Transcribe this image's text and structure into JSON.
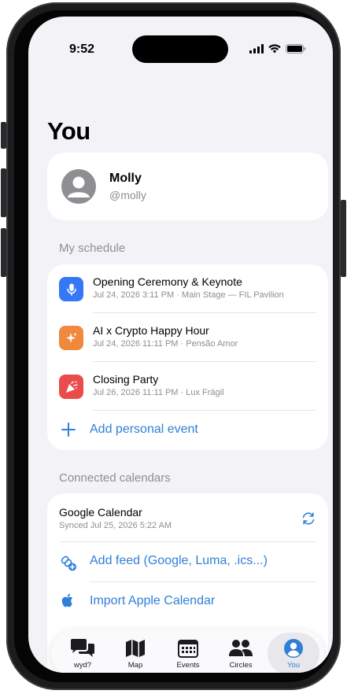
{
  "status_bar": {
    "time": "9:52"
  },
  "page": {
    "title": "You"
  },
  "profile": {
    "name": "Molly",
    "handle": "@molly"
  },
  "schedule": {
    "header": "My schedule",
    "events": [
      {
        "title": "Opening Ceremony & Keynote",
        "subtitle": "Jul 24, 2026 3:11 PM · Main Stage — FIL Pavilion",
        "icon": "microphone-icon",
        "color": "#3478f6"
      },
      {
        "title": "AI x Crypto Happy Hour",
        "subtitle": "Jul 24, 2026 11:11 PM · Pensão Amor",
        "icon": "sparkles-icon",
        "color": "#f0883e"
      },
      {
        "title": "Closing Party",
        "subtitle": "Jul 26, 2026 11:11 PM · Lux Frágil",
        "icon": "party-popper-icon",
        "color": "#ea4b4b"
      }
    ],
    "add_label": "Add personal event"
  },
  "calendars": {
    "header": "Connected calendars",
    "google": {
      "name": "Google Calendar",
      "synced": "Synced Jul 25, 2026 5:22 AM"
    },
    "add_feed_label": "Add feed (Google, Luma, .ics...)",
    "import_apple_label": "Import Apple Calendar"
  },
  "tabs": [
    {
      "label": "wyd?",
      "icon": "chat-bubbles-icon"
    },
    {
      "label": "Map",
      "icon": "map-icon"
    },
    {
      "label": "Events",
      "icon": "calendar-grid-icon"
    },
    {
      "label": "Circles",
      "icon": "people-icon"
    },
    {
      "label": "You",
      "icon": "person-circle-icon",
      "active": true
    }
  ],
  "colors": {
    "accent": "#2f7fd8",
    "background": "#f2f2f7",
    "secondary_text": "#8e8e93"
  }
}
